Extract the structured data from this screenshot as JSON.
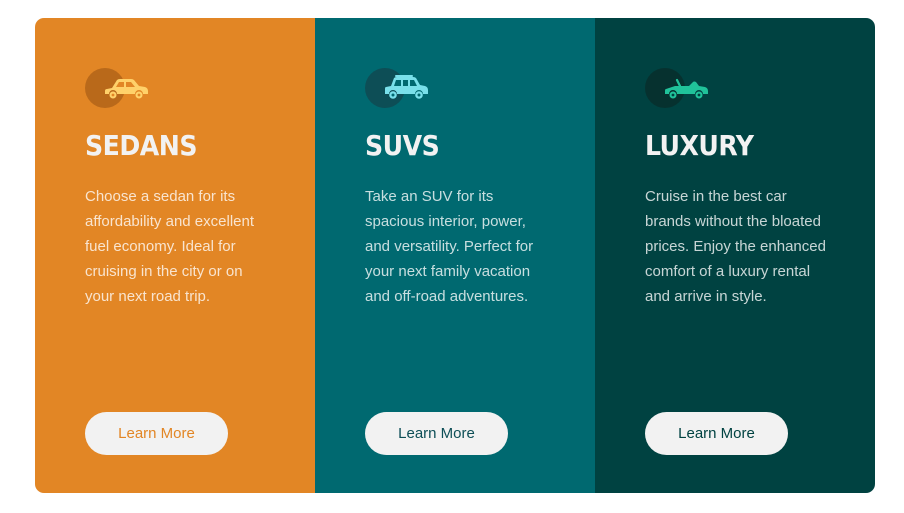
{
  "cards": [
    {
      "icon": "sedan-car-icon",
      "title": "Sedans",
      "description": "Choose a sedan for its affordability and excellent fuel economy. Ideal for cruising in the city or on your next road trip.",
      "button_label": "Learn More",
      "background_color": "#e28625"
    },
    {
      "icon": "suv-car-icon",
      "title": "SUVs",
      "description": "Take an SUV for its spacious interior, power, and versatility. Perfect for your next family vacation and off-road adventures.",
      "button_label": "Learn More",
      "background_color": "#006970"
    },
    {
      "icon": "luxury-convertible-icon",
      "title": "Luxury",
      "description": "Cruise in the best car brands without the bloated prices. Enjoy the enhanced comfort of a luxury rental and arrive in style.",
      "button_label": "Learn More",
      "background_color": "#004241"
    }
  ],
  "colors": {
    "button_background": "#f2f2f2",
    "sedan_icon": "#ffd16a",
    "suv_icon": "#79e0ea",
    "luxury_icon": "#20c29a"
  }
}
